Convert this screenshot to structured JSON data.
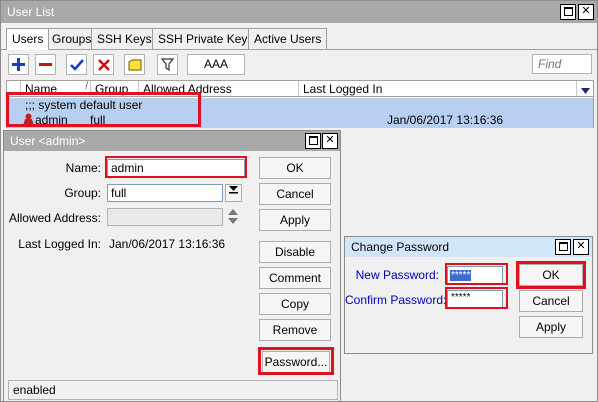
{
  "main_window": {
    "title": "User List",
    "tabs": [
      "Users",
      "Groups",
      "SSH Keys",
      "SSH Private Keys",
      "Active Users"
    ],
    "toolbar": {
      "add_icon": "plus-icon",
      "remove_icon": "minus-icon",
      "enable_icon": "check-icon",
      "disable_icon": "x-icon",
      "comment_icon": "note-icon",
      "filter_icon": "filter-icon",
      "aaa_label": "AAA",
      "find_placeholder": "Find"
    },
    "table": {
      "columns": [
        "Name",
        "Group",
        "Allowed Address",
        "Last Logged In"
      ],
      "comment_row": ";;; system default user",
      "rows": [
        {
          "name": "admin",
          "group": "full",
          "allowed_address": "",
          "last_logged_in": "Jan/06/2017 13:16:36"
        }
      ]
    }
  },
  "user_dialog": {
    "title": "User <admin>",
    "fields": {
      "name_label": "Name:",
      "name_value": "admin",
      "group_label": "Group:",
      "group_value": "full",
      "allowed_address_label": "Allowed Address:",
      "allowed_address_value": "",
      "last_logged_in_label": "Last Logged In:",
      "last_logged_in_value": "Jan/06/2017 13:16:36"
    },
    "buttons": {
      "ok": "OK",
      "cancel": "Cancel",
      "apply": "Apply",
      "disable": "Disable",
      "comment": "Comment",
      "copy": "Copy",
      "remove": "Remove",
      "password": "Password..."
    },
    "status": "enabled"
  },
  "password_dialog": {
    "title": "Change Password",
    "new_password_label": "New Password:",
    "new_password_value": "*****",
    "confirm_password_label": "Confirm Password:",
    "confirm_password_value": "*****",
    "buttons": {
      "ok": "OK",
      "cancel": "Cancel",
      "apply": "Apply"
    }
  },
  "colors": {
    "highlight_red": "#e01020",
    "selection_blue": "#b7d0f2",
    "label_blue": "#0000c0"
  }
}
